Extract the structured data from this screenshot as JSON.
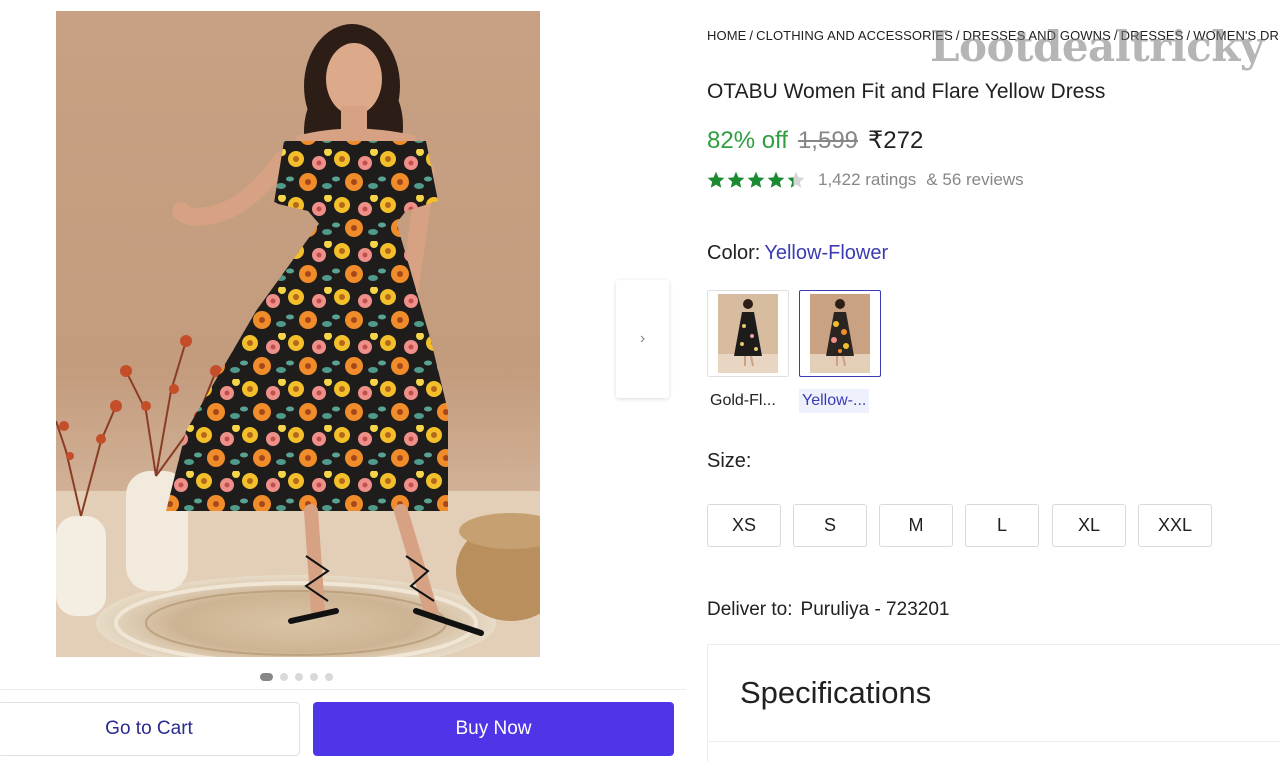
{
  "breadcrumb": [
    "HOME",
    "CLOTHING AND ACCESSORIES",
    "DRESSES AND GOWNS",
    "DRESSES",
    "WOMEN'S DRESSES"
  ],
  "watermark": "Lootdealtricky",
  "product": {
    "title": "OTABU Women Fit and Flare Yellow Dress",
    "discount": "82% off",
    "mrp": "1,599",
    "price": "₹272",
    "rating_stars": 4.3,
    "ratings_count": "1,422 ratings",
    "reviews_count": "& 56 reviews"
  },
  "color": {
    "label": "Color:",
    "selected": "Yellow-Flower",
    "options": [
      {
        "label": "Gold-Fl...",
        "selected": false
      },
      {
        "label": "Yellow-...",
        "selected": true
      }
    ]
  },
  "size": {
    "label": "Size:",
    "options": [
      "XS",
      "S",
      "M",
      "L",
      "XL",
      "XXL"
    ]
  },
  "delivery": {
    "label": "Deliver to:",
    "location": "Puruliya - 723201"
  },
  "specifications": {
    "title": "Specifications"
  },
  "carousel": {
    "count": 5,
    "active": 0
  },
  "actions": {
    "go_to_cart": "Go to Cart",
    "buy_now": "Buy Now"
  },
  "icons": {
    "next": "chevron-right-icon",
    "star": "star-icon"
  },
  "colors": {
    "accent": "#4f35e8",
    "discount": "#2e9e3f",
    "star": "#1a8b30",
    "link": "#3b3bb3"
  }
}
